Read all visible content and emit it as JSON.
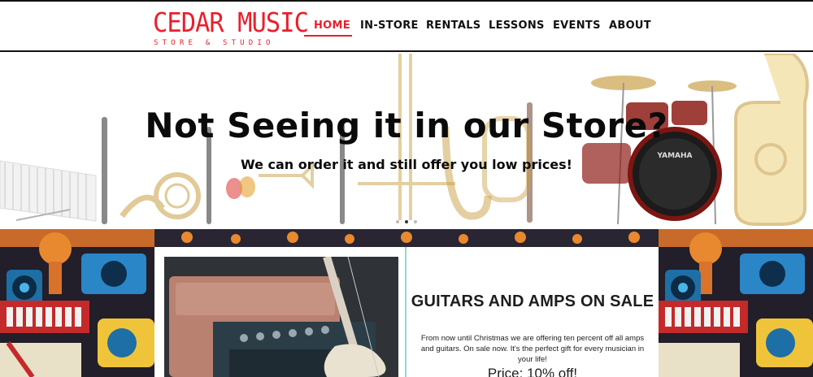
{
  "header": {
    "logo": {
      "name": "CEDAR MUSIC",
      "tagline": "STORE & STUDIO"
    },
    "nav": [
      {
        "label": "HOME",
        "active": true
      },
      {
        "label": "IN-STORE",
        "active": false
      },
      {
        "label": "RENTALS",
        "active": false
      },
      {
        "label": "LESSONS",
        "active": false
      },
      {
        "label": "EVENTS",
        "active": false
      },
      {
        "label": "ABOUT",
        "active": false
      }
    ]
  },
  "hero": {
    "title": "Not Seeing it in our Store?",
    "subtitle": "We can order it and still offer you low prices!",
    "drum_brand": "YAMAHA",
    "slides_total": 3,
    "active_slide": 2
  },
  "promo": {
    "title": "GUITARS AND AMPS ON SALE",
    "description": "From now until Christmas we are offering ten percent off all amps and guitars. On sale now. It's the perfect gift for every musician in your life!",
    "price": "Price: 10% off!"
  },
  "colors": {
    "brand_red": "#e8202d",
    "text_dark": "#111111",
    "divider_teal": "#8fd6d6"
  },
  "icons": [
    "amp-guitar-photo",
    "instrument-collage",
    "music-doodle-pattern"
  ]
}
